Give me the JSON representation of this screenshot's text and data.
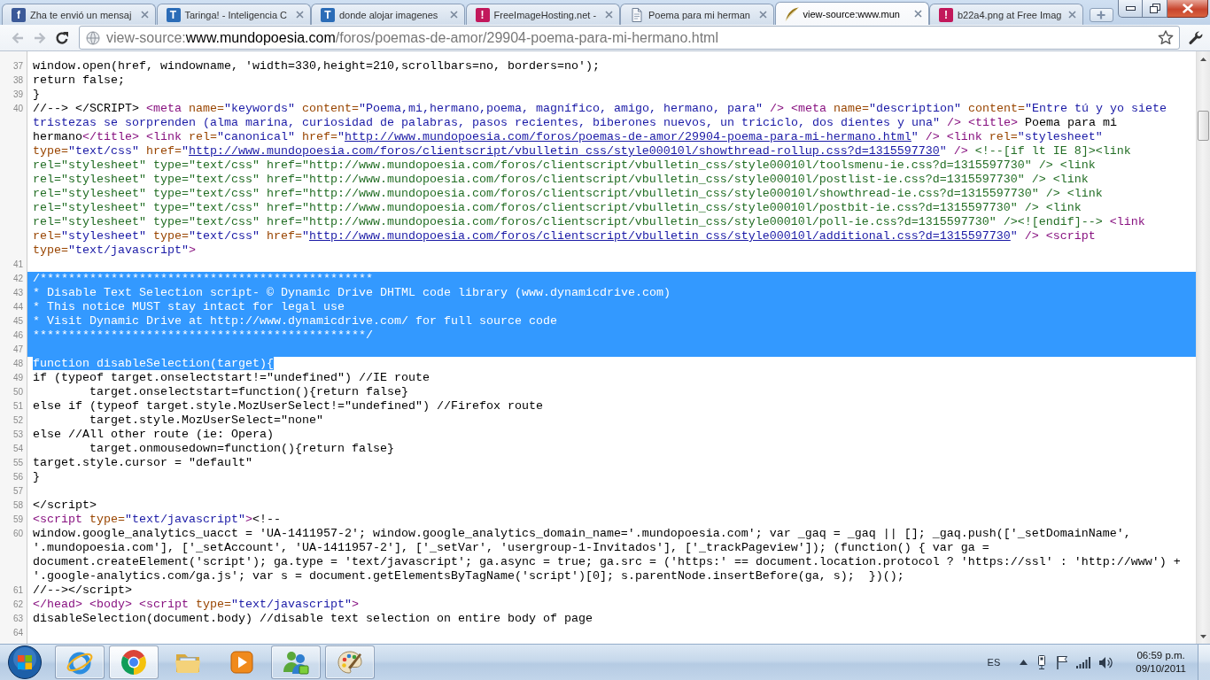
{
  "browser": {
    "tabs": [
      {
        "title": "Zha te envió un mensaj",
        "selected": false,
        "icon": {
          "kind": "letter",
          "glyph": "f",
          "color": "#3b5998"
        }
      },
      {
        "title": "Taringa! - Inteligencia C",
        "selected": false,
        "icon": {
          "kind": "letter",
          "glyph": "T",
          "color": "#2b6cb7"
        }
      },
      {
        "title": "donde alojar imagenes",
        "selected": false,
        "icon": {
          "kind": "letter",
          "glyph": "T",
          "color": "#2b6cb7"
        }
      },
      {
        "title": "FreeImageHosting.net -",
        "selected": false,
        "icon": {
          "kind": "letter",
          "glyph": "!",
          "color": "#c2185b"
        }
      },
      {
        "title": "Poema para mi herman",
        "selected": false,
        "icon": {
          "kind": "page"
        }
      },
      {
        "title": "view-source:www.mun",
        "selected": true,
        "icon": {
          "kind": "quill"
        }
      },
      {
        "title": "b22a4.png at Free Imag",
        "selected": false,
        "icon": {
          "kind": "letter",
          "glyph": "!",
          "color": "#c2185b"
        }
      }
    ],
    "toolbar": {
      "back": {
        "disabled": true
      },
      "forward": {
        "disabled": true
      },
      "address": [
        {
          "text": "view-source:",
          "emphasized": false
        },
        {
          "text": "www.mundopoesia.com",
          "emphasized": true
        },
        {
          "text": "/foros/poemas-de-amor/29904-poema-para-mi-hermano.html",
          "emphasized": false
        }
      ],
      "bookmarked": false
    }
  },
  "source": {
    "lines": [
      {
        "number": "37",
        "selected": false,
        "segments": [
          {
            "text": "window.open(href, windowname, 'width=330,height=210,scrollbars=no, borders=no');",
            "kind": "text"
          }
        ]
      },
      {
        "number": "38",
        "selected": false,
        "segments": [
          {
            "text": "return false;",
            "kind": "text"
          }
        ]
      },
      {
        "number": "39",
        "selected": false,
        "segments": [
          {
            "text": "}",
            "kind": "text"
          }
        ]
      },
      {
        "number": "40",
        "selected": false,
        "segments": [
          {
            "text": "//--> </SCRIPT> ",
            "kind": "text"
          },
          {
            "text": "<meta ",
            "kind": "tag"
          },
          {
            "text": "name=",
            "kind": "attr"
          },
          {
            "text": "\"keywords\" ",
            "kind": "value"
          },
          {
            "text": "content=",
            "kind": "attr"
          },
          {
            "text": "\"Poema,mi,hermano,poema, magnífico, amigo, hermano, para\" ",
            "kind": "value"
          },
          {
            "text": "/> <meta ",
            "kind": "tag"
          },
          {
            "text": "name=",
            "kind": "attr"
          },
          {
            "text": "\"description\" ",
            "kind": "value"
          },
          {
            "text": "content=",
            "kind": "attr"
          },
          {
            "text": "\"Entre tú y yo siete tristezas se sorprenden (alma marina, curiosidad de palabras, pasos recientes, biberones nuevos, un triciclo, dos dientes y una\" ",
            "kind": "value"
          },
          {
            "text": "/> <title>",
            "kind": "tag"
          },
          {
            "text": " Poema para mi hermano",
            "kind": "text"
          },
          {
            "text": "</title> <link ",
            "kind": "tag"
          },
          {
            "text": "rel=",
            "kind": "attr"
          },
          {
            "text": "\"canonical\" ",
            "kind": "value"
          },
          {
            "text": "href=",
            "kind": "attr"
          },
          {
            "text": "\"",
            "kind": "value"
          },
          {
            "text": "http://www.mundopoesia.com/foros/poemas-de-amor/29904-poema-para-mi-hermano.html",
            "kind": "link"
          },
          {
            "text": "\" ",
            "kind": "value"
          },
          {
            "text": "/> <link ",
            "kind": "tag"
          },
          {
            "text": "rel=",
            "kind": "attr"
          },
          {
            "text": "\"stylesheet\" ",
            "kind": "value"
          },
          {
            "text": "type=",
            "kind": "attr"
          },
          {
            "text": "\"text/css\" ",
            "kind": "value"
          },
          {
            "text": "href=",
            "kind": "attr"
          },
          {
            "text": "\"",
            "kind": "value"
          },
          {
            "text": "http://www.mundopoesia.com/foros/clientscript/vbulletin_css/style00010l/showthread-rollup.css?d=1315597730",
            "kind": "link"
          },
          {
            "text": "\" ",
            "kind": "value"
          },
          {
            "text": "/> ",
            "kind": "tag"
          },
          {
            "text": "<!--[if lt IE 8]><link rel=\"stylesheet\" type=\"text/css\" href=\"http://www.mundopoesia.com/foros/clientscript/vbulletin_css/style00010l/toolsmenu-ie.css?d=1315597730\" /> <link rel=\"stylesheet\" type=\"text/css\" href=\"http://www.mundopoesia.com/foros/clientscript/vbulletin_css/style00010l/postlist-ie.css?d=1315597730\" /> <link rel=\"stylesheet\" type=\"text/css\" href=\"http://www.mundopoesia.com/foros/clientscript/vbulletin_css/style00010l/showthread-ie.css?d=1315597730\" /> <link rel=\"stylesheet\" type=\"text/css\" href=\"http://www.mundopoesia.com/foros/clientscript/vbulletin_css/style00010l/postbit-ie.css?d=1315597730\" /> <link rel=\"stylesheet\" type=\"text/css\" href=\"http://www.mundopoesia.com/foros/clientscript/vbulletin_css/style00010l/poll-ie.css?d=1315597730\" /><![endif]-->",
            "kind": "comment"
          },
          {
            "text": " <link ",
            "kind": "tag"
          },
          {
            "text": "rel=",
            "kind": "attr"
          },
          {
            "text": "\"stylesheet\" ",
            "kind": "value"
          },
          {
            "text": "type=",
            "kind": "attr"
          },
          {
            "text": "\"text/css\" ",
            "kind": "value"
          },
          {
            "text": "href=",
            "kind": "attr"
          },
          {
            "text": "\"",
            "kind": "value"
          },
          {
            "text": "http://www.mundopoesia.com/foros/clientscript/vbulletin_css/style00010l/additional.css?d=1315597730",
            "kind": "link"
          },
          {
            "text": "\" ",
            "kind": "value"
          },
          {
            "text": "/> <script ",
            "kind": "tag"
          },
          {
            "text": "type=",
            "kind": "attr"
          },
          {
            "text": "\"text/javascript\"",
            "kind": "value"
          },
          {
            "text": ">",
            "kind": "tag"
          }
        ]
      },
      {
        "number": "41",
        "selected": false
      },
      {
        "number": "42",
        "selected": true,
        "segments": [
          {
            "text": "/***********************************************",
            "kind": "text"
          }
        ]
      },
      {
        "number": "43",
        "selected": true,
        "segments": [
          {
            "text": "* Disable Text Selection script- © Dynamic Drive DHTML code library (www.dynamicdrive.com)",
            "kind": "text"
          }
        ]
      },
      {
        "number": "44",
        "selected": true,
        "segments": [
          {
            "text": "* This notice MUST stay intact for legal use",
            "kind": "text"
          }
        ]
      },
      {
        "number": "45",
        "selected": true,
        "segments": [
          {
            "text": "* Visit Dynamic Drive at http://www.dynamicdrive.com/ for full source code",
            "kind": "text"
          }
        ]
      },
      {
        "number": "46",
        "selected": true,
        "segments": [
          {
            "text": "***********************************************/",
            "kind": "text"
          }
        ]
      },
      {
        "number": "47",
        "selected": true
      },
      {
        "number": "48",
        "selected": true,
        "segments": [
          {
            "text": "function disableSelection(target){",
            "kind": "text"
          }
        ]
      },
      {
        "number": "49",
        "selected": false,
        "segments": [
          {
            "text": "if (typeof target.onselectstart!=\"undefined\") //IE route",
            "kind": "text"
          }
        ]
      },
      {
        "number": "50",
        "selected": false,
        "segments": [
          {
            "text": "\ttarget.onselectstart=function(){return false}",
            "kind": "text"
          }
        ]
      },
      {
        "number": "51",
        "selected": false,
        "segments": [
          {
            "text": "else if (typeof target.style.MozUserSelect!=\"undefined\") //Firefox route",
            "kind": "text"
          }
        ]
      },
      {
        "number": "52",
        "selected": false,
        "segments": [
          {
            "text": "\ttarget.style.MozUserSelect=\"none\"",
            "kind": "text"
          }
        ]
      },
      {
        "number": "53",
        "selected": false,
        "segments": [
          {
            "text": "else //All other route (ie: Opera)",
            "kind": "text"
          }
        ]
      },
      {
        "number": "54",
        "selected": false,
        "segments": [
          {
            "text": "\ttarget.onmousedown=function(){return false}",
            "kind": "text"
          }
        ]
      },
      {
        "number": "55",
        "selected": false,
        "segments": [
          {
            "text": "target.style.cursor = \"default\"",
            "kind": "text"
          }
        ]
      },
      {
        "number": "56",
        "selected": false,
        "segments": [
          {
            "text": "}",
            "kind": "text"
          }
        ]
      },
      {
        "number": "57",
        "selected": false
      },
      {
        "number": "58",
        "selected": false,
        "segments": [
          {
            "text": "</script>",
            "kind": "text"
          }
        ]
      },
      {
        "number": "59",
        "selected": false,
        "segments": [
          {
            "text": "<script ",
            "kind": "tag"
          },
          {
            "text": "type=",
            "kind": "attr"
          },
          {
            "text": "\"text/javascript\"",
            "kind": "value"
          },
          {
            "text": ">",
            "kind": "tag"
          },
          {
            "text": "<!--",
            "kind": "text"
          }
        ]
      },
      {
        "number": "60",
        "selected": false,
        "segments": [
          {
            "text": "window.google_analytics_uacct = 'UA-1411957-2'; window.google_analytics_domain_name='.mundopoesia.com'; var _gaq = _gaq || []; _gaq.push(['_setDomainName', '.mundopoesia.com'], ['_setAccount', 'UA-1411957-2'], ['_setVar', 'usergroup-1-Invitados'], ['_trackPageview']); (function() { var ga = document.createElement('script'); ga.type = 'text/javascript'; ga.async = true; ga.src = ('https:' == document.location.protocol ? 'https://ssl' : 'http://www') + '.google-analytics.com/ga.js'; var s = document.getElementsByTagName('script')[0]; s.parentNode.insertBefore(ga, s);  })();",
            "kind": "text"
          }
        ]
      },
      {
        "number": "61",
        "selected": false,
        "segments": [
          {
            "text": "//--></script>",
            "kind": "text"
          }
        ]
      },
      {
        "number": "62",
        "selected": false,
        "segments": [
          {
            "text": "</head> <body> <script ",
            "kind": "tag"
          },
          {
            "text": "type=",
            "kind": "attr"
          },
          {
            "text": "\"text/javascript\"",
            "kind": "value"
          },
          {
            "text": ">",
            "kind": "tag"
          }
        ]
      },
      {
        "number": "63",
        "selected": false,
        "segments": [
          {
            "text": "disableSelection(document.body) //disable text selection on entire body of page",
            "kind": "text"
          }
        ]
      },
      {
        "number": "64",
        "selected": false
      }
    ]
  },
  "taskbar": {
    "apps": [
      {
        "kind": "globe",
        "running": true,
        "selected": false
      },
      {
        "kind": "ball",
        "running": true,
        "selected": true
      },
      {
        "kind": "folder",
        "running": false,
        "selected": false
      },
      {
        "kind": "player",
        "running": false,
        "selected": false
      },
      {
        "kind": "people",
        "running": true,
        "selected": false
      },
      {
        "kind": "palette",
        "running": true,
        "selected": false
      }
    ],
    "language": "ES",
    "time": "06:59 p.m.",
    "date": "09/10/2011"
  }
}
